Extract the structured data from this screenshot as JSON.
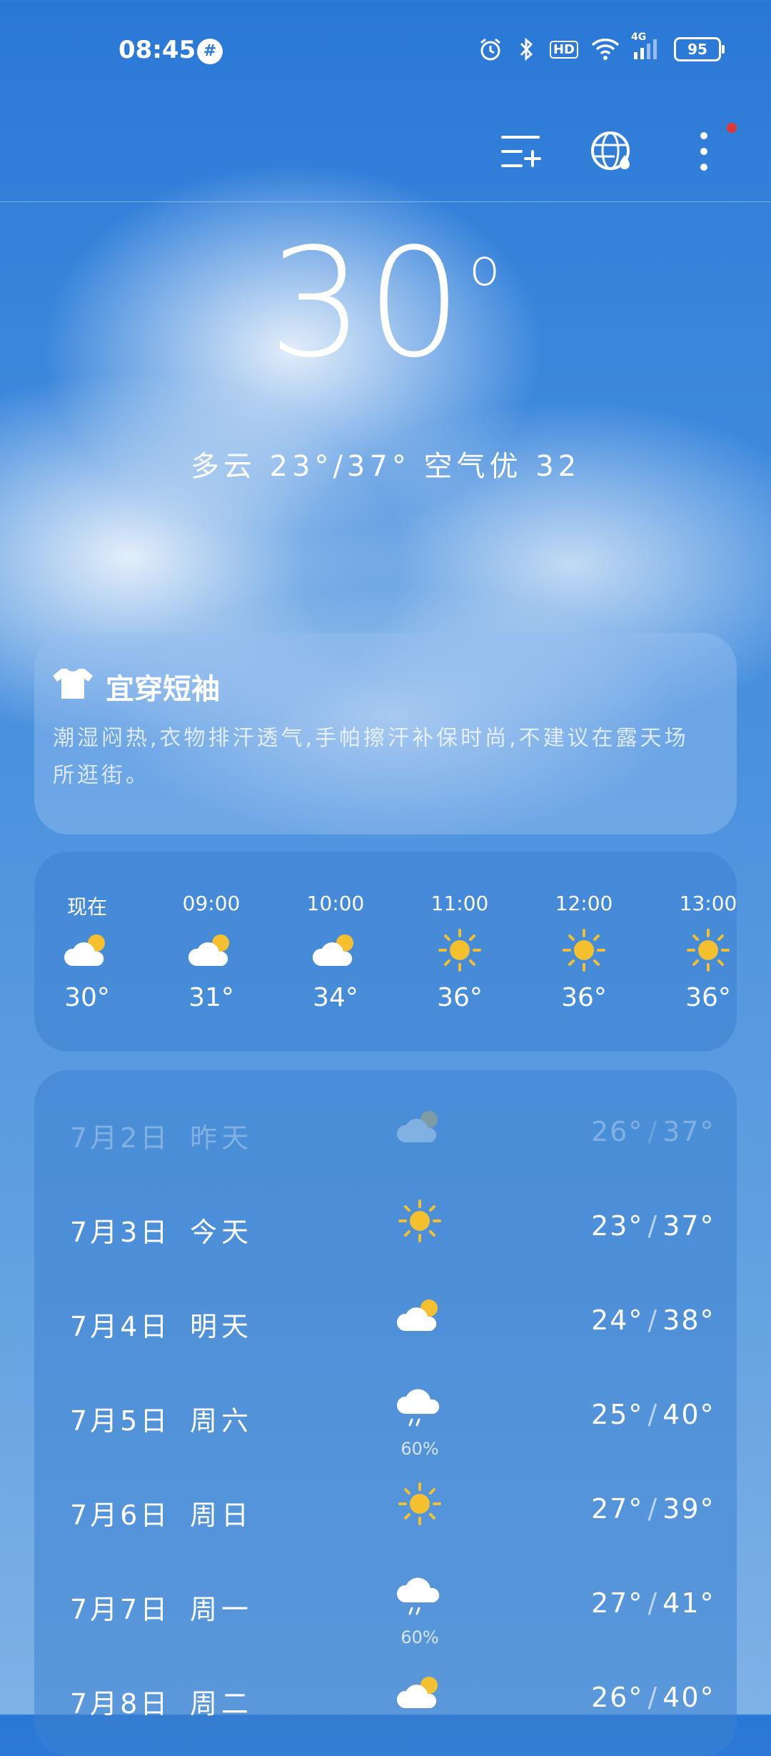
{
  "status": {
    "time": "08:45",
    "notif_glyph": "#",
    "icons": [
      "alarm-icon",
      "bluetooth-icon",
      "hd-icon",
      "wifi-icon",
      "signal-4g-icon"
    ],
    "hd_label": "HD",
    "net_label": "4G",
    "battery": "95"
  },
  "header": {
    "icons": [
      "add-city-icon",
      "globe-rain-icon",
      "more-icon"
    ]
  },
  "current": {
    "temp": "30",
    "summary": "多云 23°/37° 空气优 32"
  },
  "tip": {
    "title": "宜穿短袖",
    "text": "潮湿闷热,衣物排汗透气,手帕擦汗补保时尚,不建议在露天场所逛街。"
  },
  "hourly": [
    {
      "time": "现在",
      "icon": "partly-cloudy-icon",
      "temp": "30°"
    },
    {
      "time": "09:00",
      "icon": "partly-cloudy-icon",
      "temp": "31°"
    },
    {
      "time": "10:00",
      "icon": "partly-cloudy-icon",
      "temp": "34°"
    },
    {
      "time": "11:00",
      "icon": "sunny-icon",
      "temp": "36°"
    },
    {
      "time": "12:00",
      "icon": "sunny-icon",
      "temp": "36°"
    },
    {
      "time": "13:00",
      "icon": "sunny-icon",
      "temp": "36°"
    }
  ],
  "daily": [
    {
      "date": "7月2日",
      "name": "昨天",
      "icon": "partly-cloudy-icon",
      "rain": "",
      "low": "26°",
      "high": "37°"
    },
    {
      "date": "7月3日",
      "name": "今天",
      "icon": "sunny-icon",
      "rain": "",
      "low": "23°",
      "high": "37°"
    },
    {
      "date": "7月4日",
      "name": "明天",
      "icon": "partly-cloudy-icon",
      "rain": "",
      "low": "24°",
      "high": "38°"
    },
    {
      "date": "7月5日",
      "name": "周六",
      "icon": "rain-icon",
      "rain": "60%",
      "low": "25°",
      "high": "40°"
    },
    {
      "date": "7月6日",
      "name": "周日",
      "icon": "sunny-icon",
      "rain": "",
      "low": "27°",
      "high": "39°"
    },
    {
      "date": "7月7日",
      "name": "周一",
      "icon": "rain-icon",
      "rain": "60%",
      "low": "27°",
      "high": "41°"
    },
    {
      "date": "7月8日",
      "name": "周二",
      "icon": "partly-cloudy-icon",
      "rain": "",
      "low": "26°",
      "high": "40°"
    }
  ]
}
